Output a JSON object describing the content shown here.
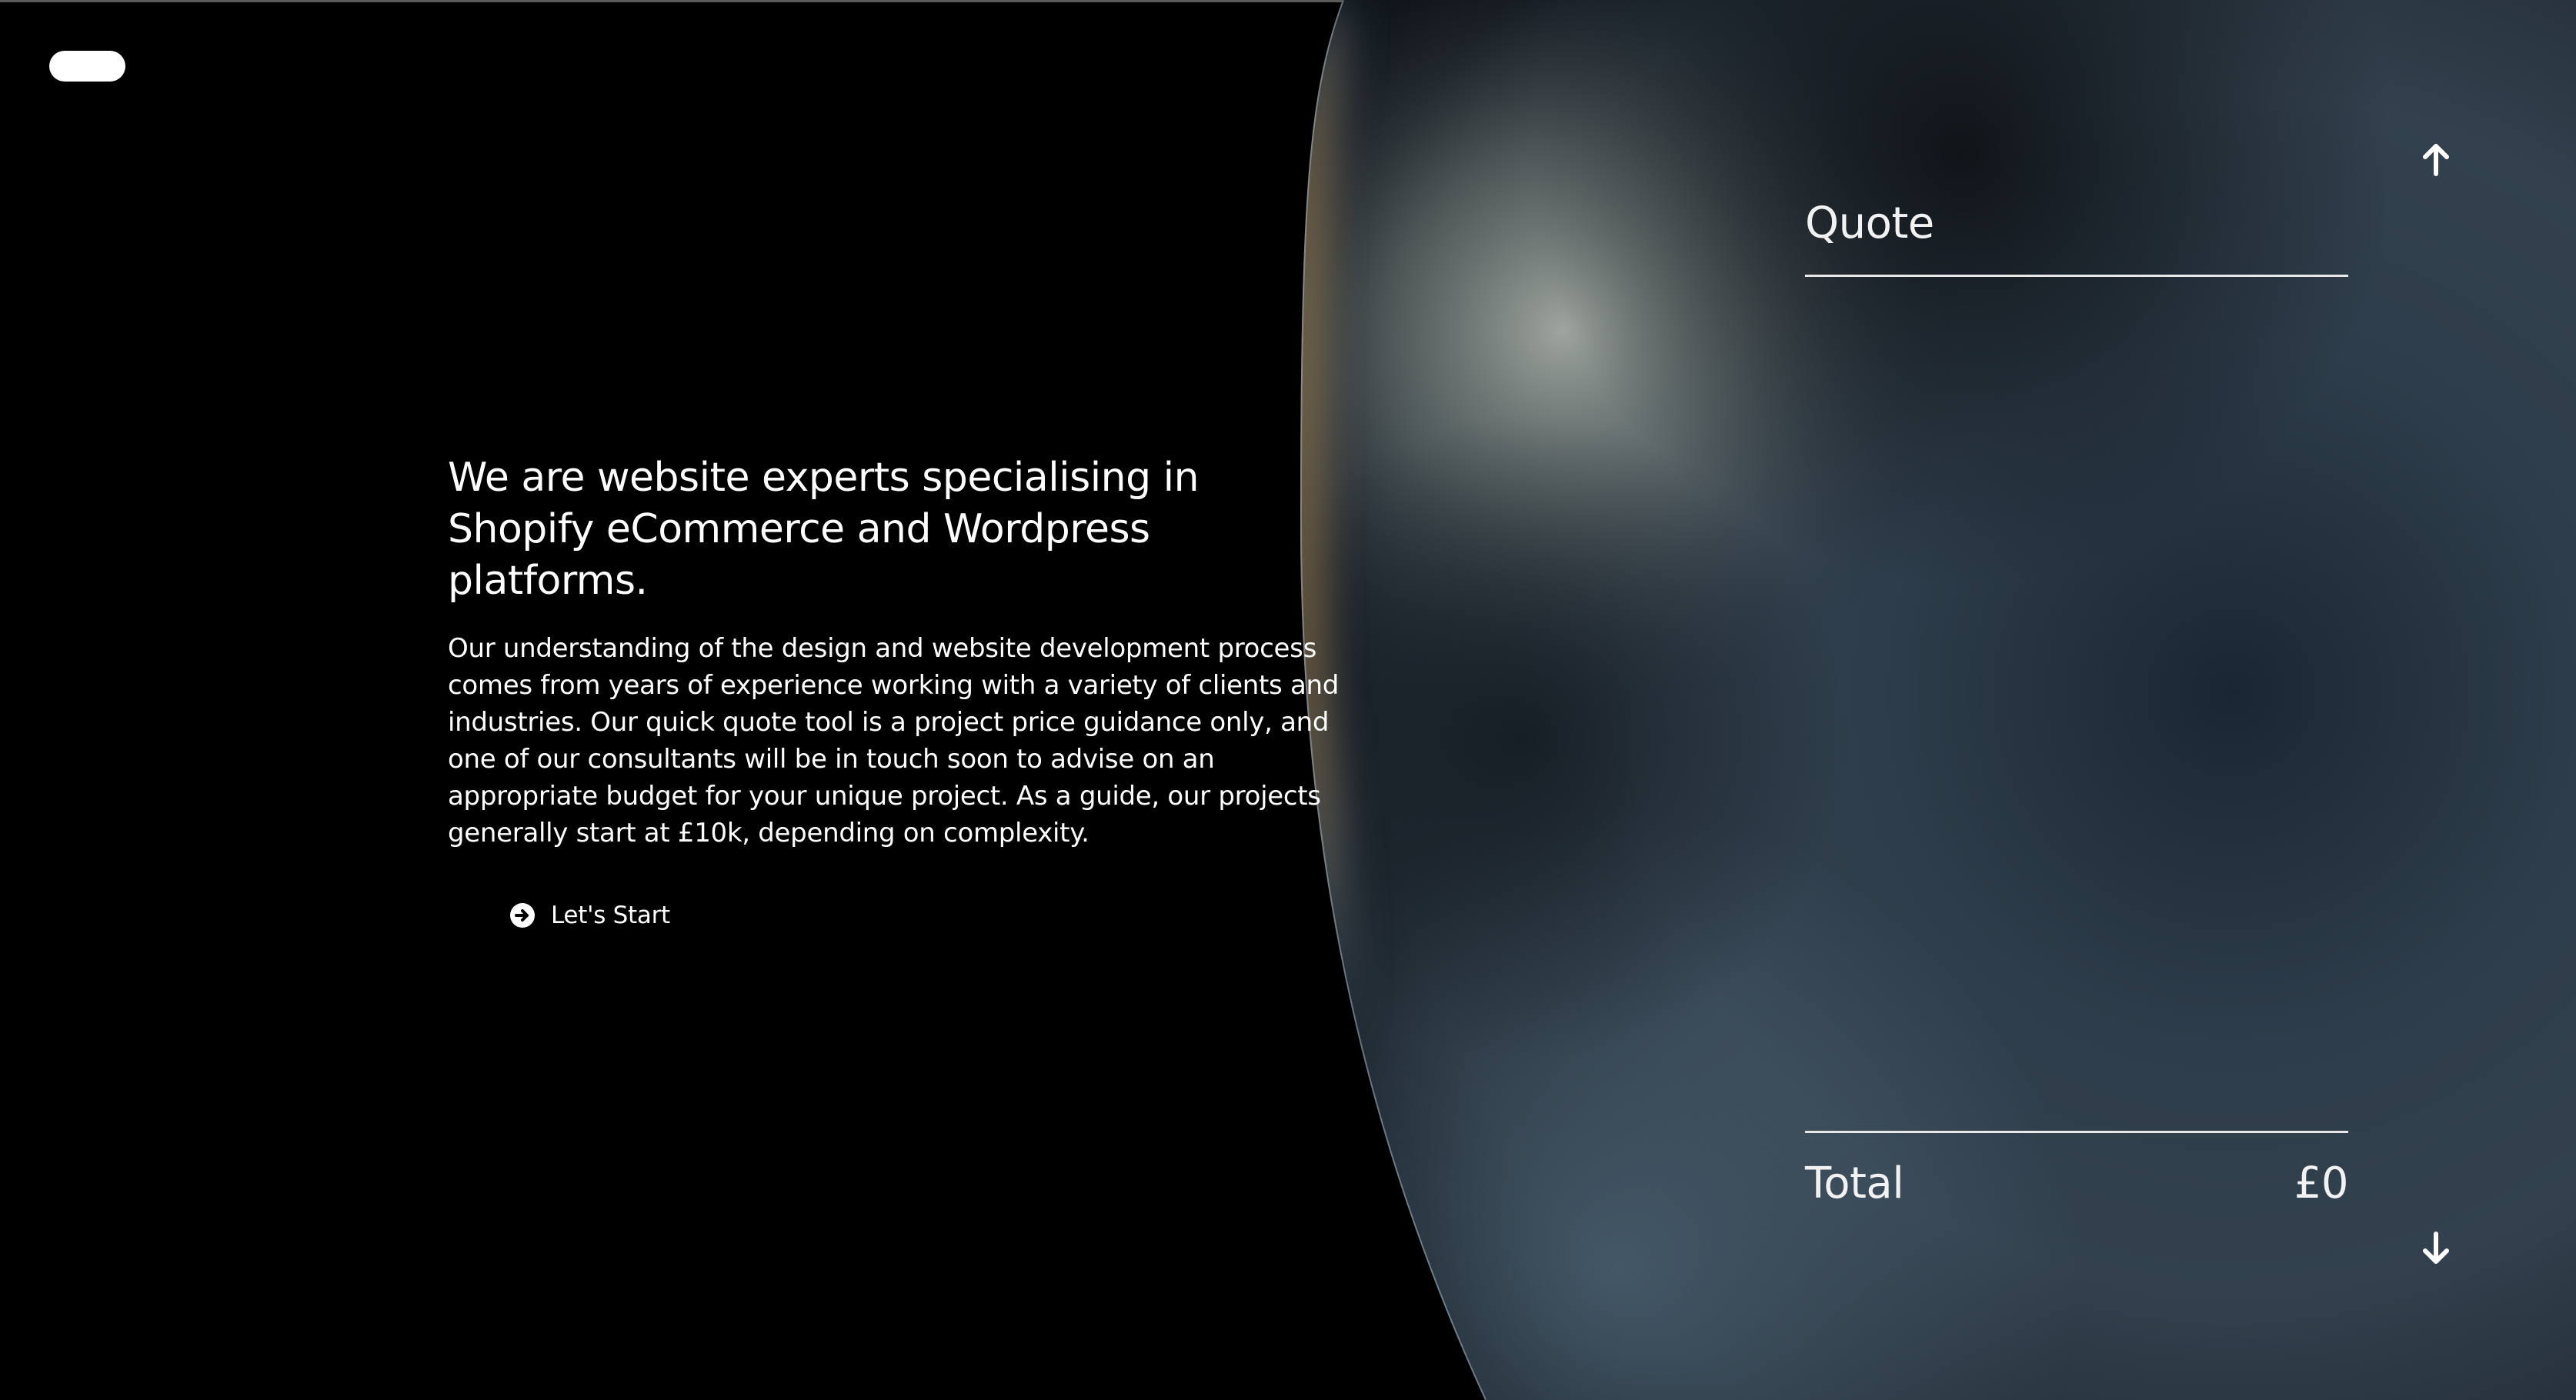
{
  "header": {
    "menu_button": "menu-pill"
  },
  "hero": {
    "heading": "We are website experts specialising in Shopify eCommerce and Wordpress platforms.",
    "body": "Our understanding of the design and website development process comes from years of experience working with a variety of clients and industries. Our quick quote tool is a project price guidance only, and one of our consultants will be in touch soon to advise on an appropriate budget for your unique project. As a guide, our projects generally start at £10k, depending on complexity.",
    "cta_label": "Let's Start",
    "cta_icon": "arrow-circle-right-icon"
  },
  "quote_panel": {
    "title": "Quote",
    "total_label": "Total",
    "total_value": "£0",
    "scroll_up_icon": "arrow-up-icon",
    "scroll_down_icon": "arrow-down-icon"
  },
  "colors": {
    "background": "#000000",
    "text": "#ffffff",
    "rule": "#e8e8e8",
    "sphere_highlight": "#9aa39f",
    "sphere_body": "#2b3a48",
    "sphere_rim_warm": "#c9a060"
  }
}
